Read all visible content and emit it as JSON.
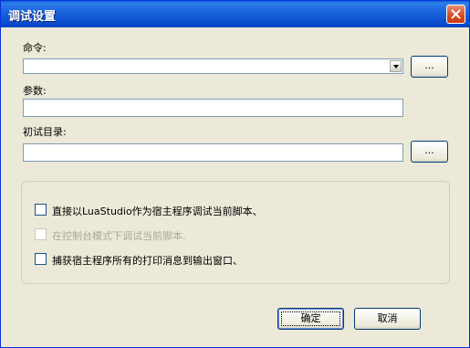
{
  "window": {
    "title": "调试设置"
  },
  "command": {
    "label": "命令:",
    "value": "",
    "browse_label": "..."
  },
  "params": {
    "label": "参数:",
    "value": ""
  },
  "workdir": {
    "label": "初试目录:",
    "value": "",
    "browse_label": "..."
  },
  "options": [
    {
      "label": "直接以LuaStudio作为宿主程序调试当前脚本、",
      "checked": false,
      "disabled": false
    },
    {
      "label": "在控制台模式下调试当前脚本.",
      "checked": false,
      "disabled": true
    },
    {
      "label": "捕获宿主程序所有的打印消息到输出窗口、",
      "checked": false,
      "disabled": false
    }
  ],
  "buttons": {
    "ok": "确定",
    "cancel": "取消"
  },
  "colors": {
    "titlebar": "#0b4fd0",
    "dialog_bg": "#ece9d8",
    "close": "#d6491d"
  }
}
